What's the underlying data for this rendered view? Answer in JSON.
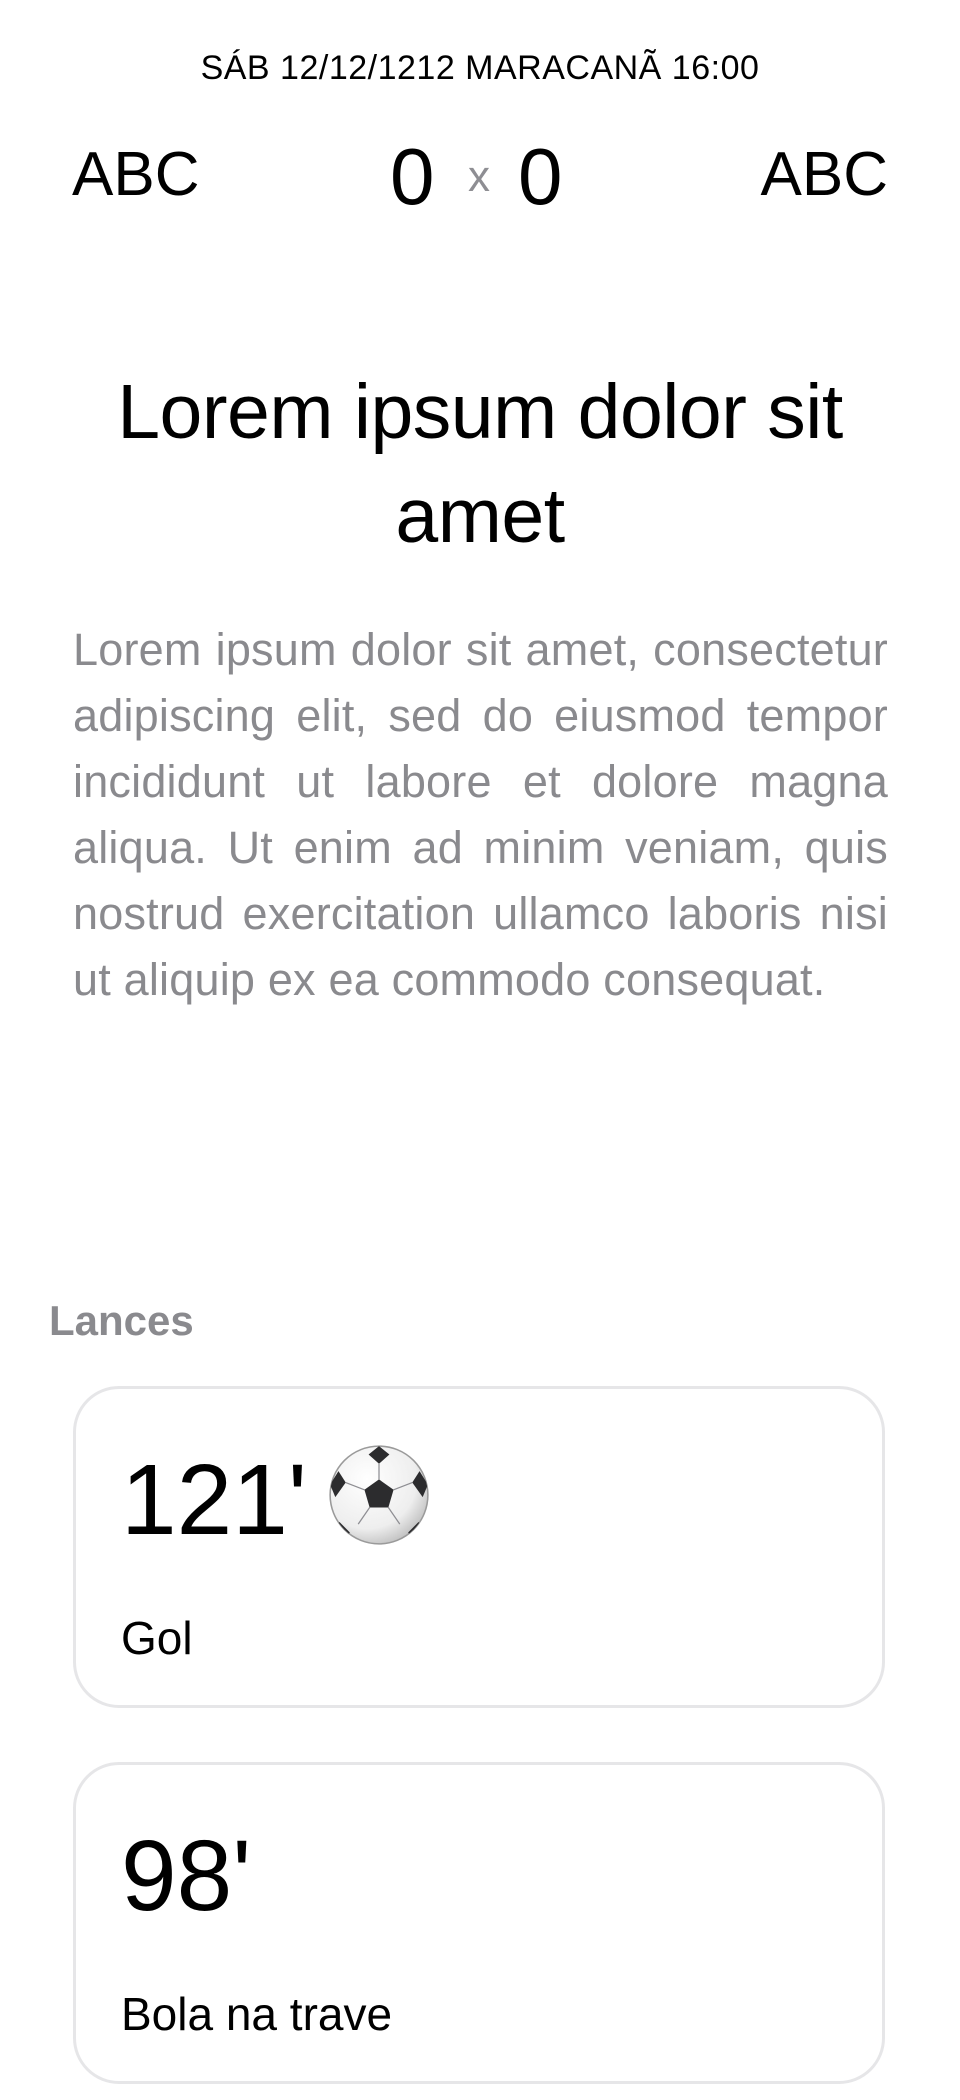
{
  "header": {
    "match_info": "SÁB 12/12/1212 MARACANÃ 16:00",
    "home_team": "ABC",
    "away_team": "ABC",
    "home_score": "0",
    "away_score": "0",
    "score_separator": "x"
  },
  "article": {
    "title": "Lorem ipsum dolor sit amet",
    "body": "Lorem ipsum dolor sit amet, consectetur adipiscing elit, sed do eiusmod tempor incididunt ut labore et dolore magna aliqua. Ut enim ad minim veniam, quis nostrud exercitation ullamco laboris nisi ut aliquip ex ea commodo consequat."
  },
  "plays": {
    "section_title": "Lances",
    "items": [
      {
        "minute": "121'",
        "label": "Gol",
        "icon": "soccer-ball-icon"
      },
      {
        "minute": "98'",
        "label": "Bola na trave"
      }
    ]
  }
}
